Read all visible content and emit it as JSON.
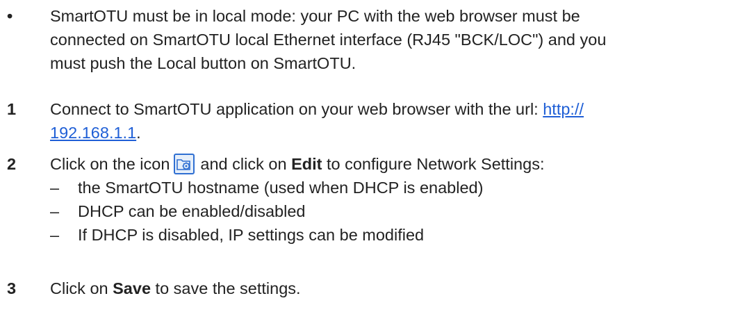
{
  "intro": {
    "bullet": "•",
    "lines": [
      "SmartOTU must be in local mode: your PC with the web browser must be",
      "connected on SmartOTU local Ethernet interface (RJ45 \"BCK/LOC\") and you",
      "must push the Local button on SmartOTU."
    ]
  },
  "steps": [
    {
      "number": "1",
      "line1": "Connect to SmartOTU application on your web browser with the url: ",
      "link_part1": "http://",
      "link_part2": "192.168.1.1",
      "after_link": "."
    },
    {
      "number": "2",
      "before_icon": "Click on the icon",
      "icon": "settings-folder-icon",
      "mid": "and click on ",
      "bold": "Edit",
      "after": " to configure Network Settings:",
      "sub_items": [
        "the SmartOTU hostname (used when DHCP is enabled)",
        "DHCP can be enabled/disabled",
        "If DHCP is disabled, IP settings can be modified"
      ],
      "dash": "–"
    },
    {
      "number": "3",
      "before": "Click on ",
      "bold": "Save",
      "after": " to save the settings."
    }
  ],
  "colors": {
    "text": "#222222",
    "link": "#1f5fd6",
    "icon_border": "#2f6fd2"
  }
}
